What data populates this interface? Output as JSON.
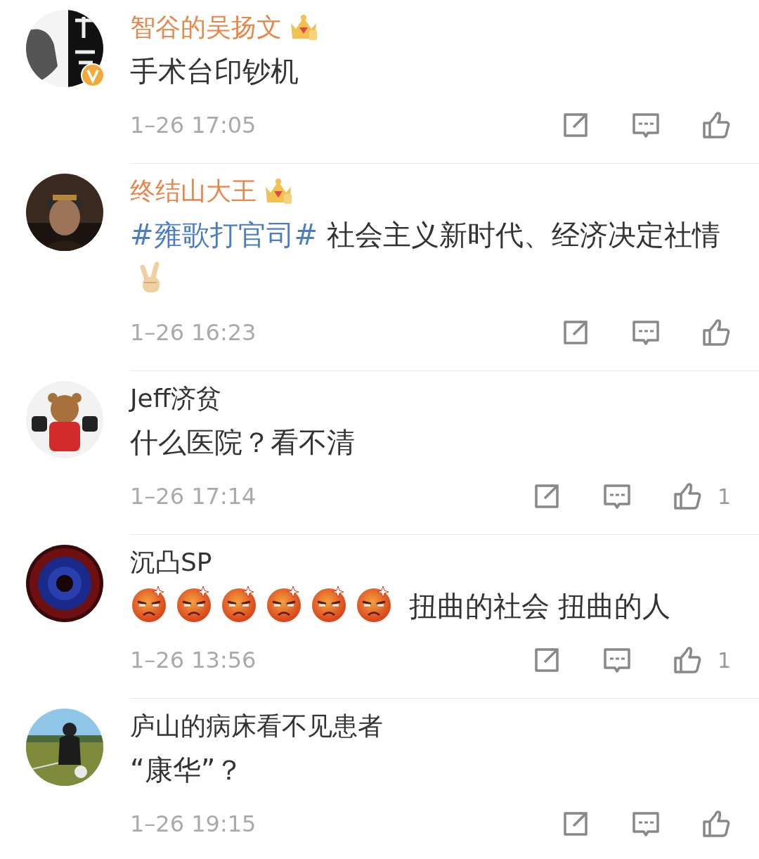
{
  "comments": [
    {
      "avatar": {
        "kind": "picture",
        "verified": true
      },
      "name": "智谷的吴扬文",
      "vip": true,
      "content": [
        {
          "kind": "text",
          "text": "手术台印钞机"
        }
      ],
      "time": "1–26 17:05"
    },
    {
      "avatar": {
        "kind": "picture",
        "verified": false
      },
      "name": "终结山大王",
      "vip": true,
      "content": [
        {
          "kind": "topic",
          "text": "#雍歌打官司#"
        },
        {
          "kind": "text",
          "text": " 社会主义新时代、经济决定社情"
        },
        {
          "kind": "victory-emoji"
        }
      ],
      "time": "1–26 16:23"
    },
    {
      "avatar": {
        "kind": "picture",
        "verified": false
      },
      "name": "Jeff济贫",
      "vip": false,
      "content": [
        {
          "kind": "text",
          "text": "什么医院？看不清"
        }
      ],
      "time": "1–26 17:14",
      "likes": "1"
    },
    {
      "avatar": {
        "kind": "picture",
        "verified": false
      },
      "name": "沉凸SP",
      "vip": false,
      "content": [
        {
          "kind": "angry-emoji"
        },
        {
          "kind": "angry-emoji"
        },
        {
          "kind": "angry-emoji"
        },
        {
          "kind": "angry-emoji"
        },
        {
          "kind": "angry-emoji"
        },
        {
          "kind": "angry-emoji"
        },
        {
          "kind": "text",
          "text": " 扭曲的社会 扭曲的人"
        }
      ],
      "time": "1–26 13:56",
      "likes": "1"
    },
    {
      "avatar": {
        "kind": "picture",
        "verified": false
      },
      "name": "庐山的病床看不见患者",
      "vip": false,
      "content": [
        {
          "kind": "text",
          "text": "“康华”？"
        }
      ],
      "time": "1–26 19:15"
    }
  ]
}
